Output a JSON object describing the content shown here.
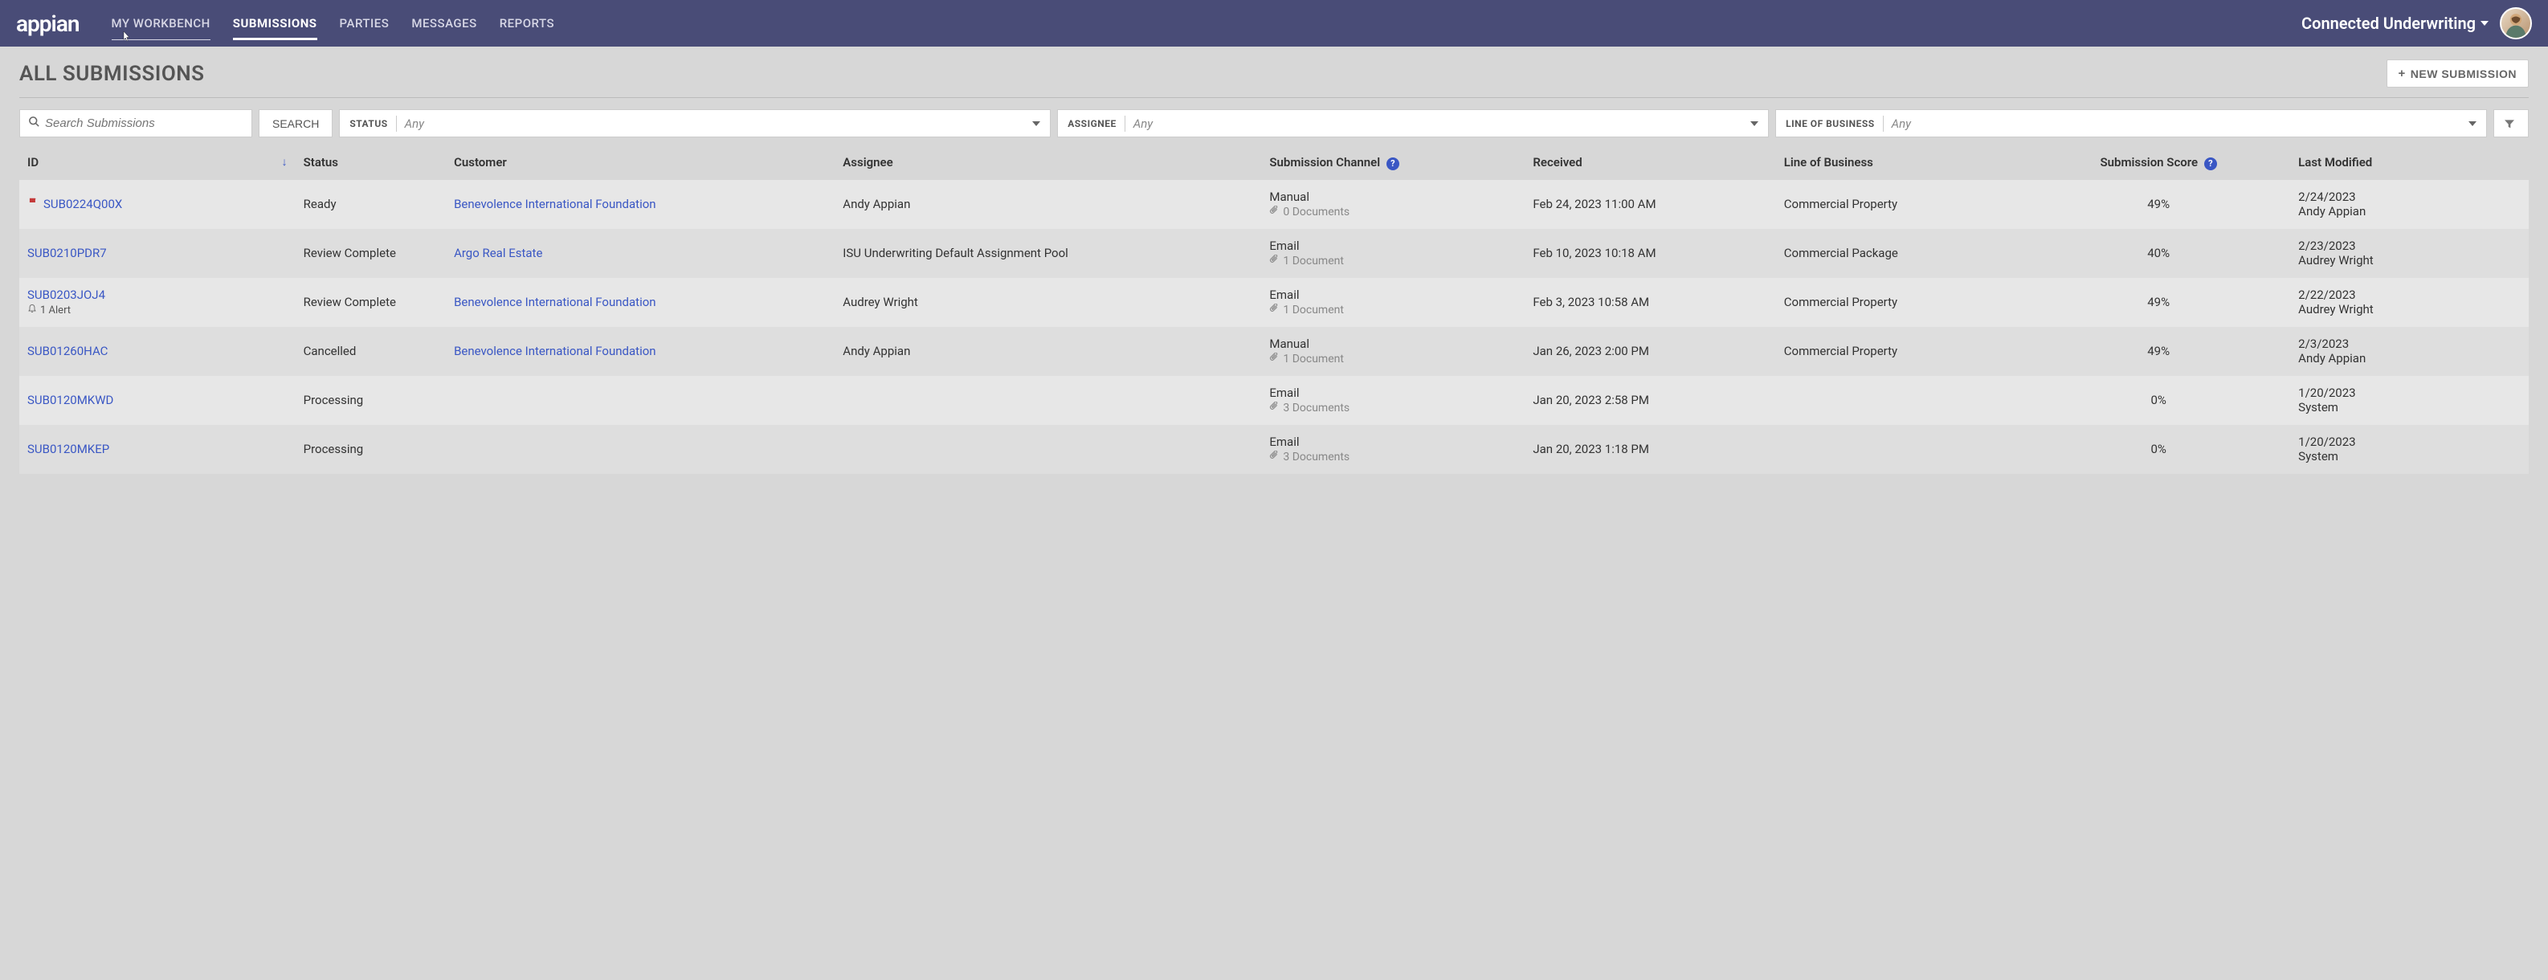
{
  "topbar": {
    "logo": "appian",
    "nav": [
      {
        "label": "MY WORKBENCH",
        "active": false,
        "hover": true
      },
      {
        "label": "SUBMISSIONS",
        "active": true,
        "hover": false
      },
      {
        "label": "PARTIES",
        "active": false,
        "hover": false
      },
      {
        "label": "MESSAGES",
        "active": false,
        "hover": false
      },
      {
        "label": "REPORTS",
        "active": false,
        "hover": false
      }
    ],
    "app_title": "Connected Underwriting"
  },
  "page": {
    "title": "ALL SUBMISSIONS",
    "new_button": "NEW SUBMISSION"
  },
  "search": {
    "placeholder": "Search Submissions",
    "button": "SEARCH"
  },
  "filters": {
    "status": {
      "label": "STATUS",
      "value": "Any"
    },
    "assignee": {
      "label": "ASSIGNEE",
      "value": "Any"
    },
    "lob": {
      "label": "LINE OF BUSINESS",
      "value": "Any"
    }
  },
  "columns": {
    "id": "ID",
    "status": "Status",
    "customer": "Customer",
    "assignee": "Assignee",
    "channel": "Submission Channel",
    "received": "Received",
    "lob": "Line of Business",
    "score": "Submission Score",
    "modified": "Last Modified"
  },
  "rows": [
    {
      "id": "SUB0224Q00X",
      "flag": true,
      "alert": "",
      "status": "Ready",
      "customer": "Benevolence International Foundation",
      "assignee": "Andy Appian",
      "channel": "Manual",
      "docs": "0 Documents",
      "received": "Feb 24, 2023 11:00 AM",
      "lob": "Commercial Property",
      "score": "49%",
      "modified_date": "2/24/2023",
      "modified_by": "Andy Appian"
    },
    {
      "id": "SUB0210PDR7",
      "flag": false,
      "alert": "",
      "status": "Review Complete",
      "customer": "Argo Real Estate",
      "assignee": "ISU Underwriting Default Assignment Pool",
      "channel": "Email",
      "docs": "1 Document",
      "received": "Feb 10, 2023 10:18 AM",
      "lob": "Commercial Package",
      "score": "40%",
      "modified_date": "2/23/2023",
      "modified_by": "Audrey Wright"
    },
    {
      "id": "SUB0203JOJ4",
      "flag": false,
      "alert": "1 Alert",
      "status": "Review Complete",
      "customer": "Benevolence International Foundation",
      "assignee": "Audrey Wright",
      "channel": "Email",
      "docs": "1 Document",
      "received": "Feb 3, 2023 10:58 AM",
      "lob": "Commercial Property",
      "score": "49%",
      "modified_date": "2/22/2023",
      "modified_by": "Audrey Wright"
    },
    {
      "id": "SUB01260HAC",
      "flag": false,
      "alert": "",
      "status": "Cancelled",
      "customer": "Benevolence International Foundation",
      "assignee": "Andy Appian",
      "channel": "Manual",
      "docs": "1 Document",
      "received": "Jan 26, 2023 2:00 PM",
      "lob": "Commercial Property",
      "score": "49%",
      "modified_date": "2/3/2023",
      "modified_by": "Andy Appian"
    },
    {
      "id": "SUB0120MKWD",
      "flag": false,
      "alert": "",
      "status": "Processing",
      "customer": "",
      "assignee": "",
      "channel": "Email",
      "docs": "3 Documents",
      "received": "Jan 20, 2023 2:58 PM",
      "lob": "",
      "score": "0%",
      "modified_date": "1/20/2023",
      "modified_by": "System"
    },
    {
      "id": "SUB0120MKEP",
      "flag": false,
      "alert": "",
      "status": "Processing",
      "customer": "",
      "assignee": "",
      "channel": "Email",
      "docs": "3 Documents",
      "received": "Jan 20, 2023 1:18 PM",
      "lob": "",
      "score": "0%",
      "modified_date": "1/20/2023",
      "modified_by": "System"
    }
  ]
}
